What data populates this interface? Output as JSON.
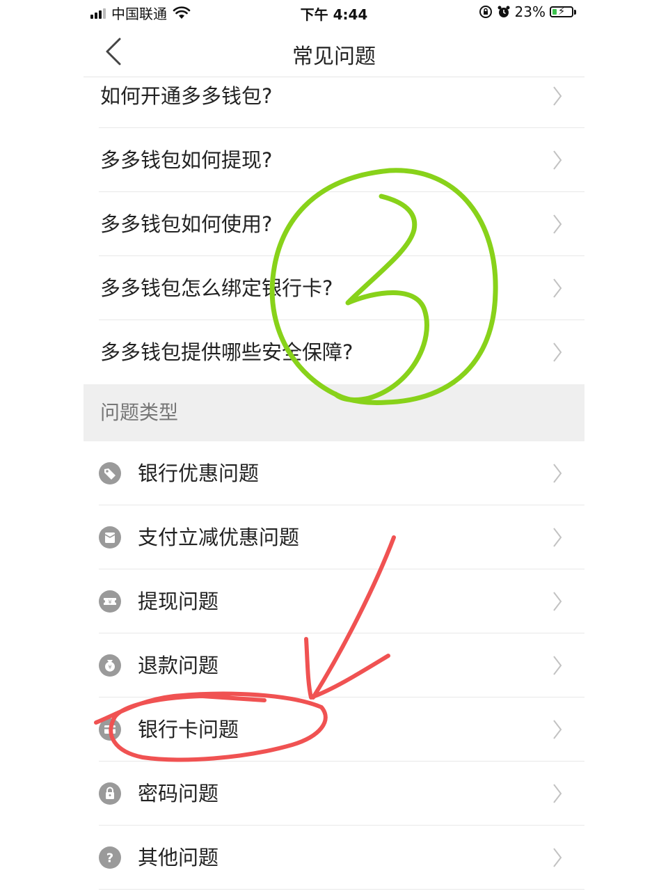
{
  "status_bar": {
    "carrier": "中国联通",
    "time": "下午 4:44",
    "battery": "23%",
    "battery_level": 0.23
  },
  "nav": {
    "title": "常见问题"
  },
  "faq_items": [
    {
      "label": "如何开通多多钱包?"
    },
    {
      "label": "多多钱包如何提现?"
    },
    {
      "label": "多多钱包如何使用?"
    },
    {
      "label": "多多钱包怎么绑定银行卡?"
    },
    {
      "label": "多多钱包提供哪些安全保障?"
    }
  ],
  "section": {
    "title": "问题类型"
  },
  "categories": [
    {
      "label": "银行优惠问题",
      "icon": "tag-icon"
    },
    {
      "label": "支付立减优惠问题",
      "icon": "envelope-icon"
    },
    {
      "label": "提现问题",
      "icon": "ticket-icon"
    },
    {
      "label": "退款问题",
      "icon": "money-bag-icon"
    },
    {
      "label": "银行卡问题",
      "icon": "bank-card-icon"
    },
    {
      "label": "密码问题",
      "icon": "lock-icon"
    },
    {
      "label": "其他问题",
      "icon": "question-icon"
    }
  ],
  "colors": {
    "annotation_green": "#88d21a",
    "annotation_red": "#f05252",
    "icon_gray": "#9a9a9a"
  },
  "annotations": {
    "circled_number": "3"
  }
}
